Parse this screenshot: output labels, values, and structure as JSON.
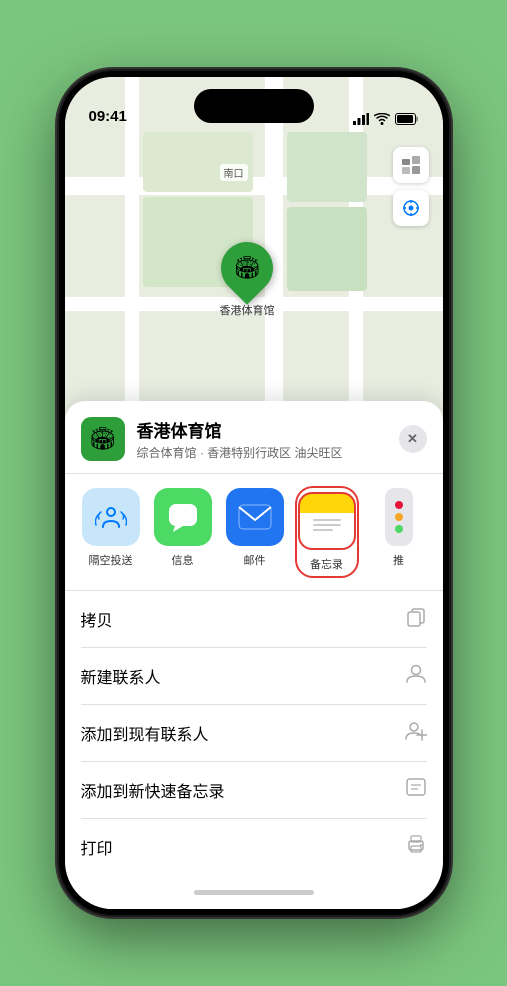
{
  "status_bar": {
    "time": "09:41",
    "signal": "●●●●",
    "wifi": "WiFi",
    "battery": "Battery"
  },
  "map": {
    "label_nk": "南口"
  },
  "venue": {
    "name": "香港体育馆",
    "subtitle": "综合体育馆 · 香港特别行政区 油尖旺区",
    "pin_label": "香港体育馆"
  },
  "close_button_label": "✕",
  "share_items": [
    {
      "id": "airdrop",
      "label": "隔空投送",
      "icon_type": "airdrop"
    },
    {
      "id": "messages",
      "label": "信息",
      "icon_type": "messages"
    },
    {
      "id": "mail",
      "label": "邮件",
      "icon_type": "mail"
    },
    {
      "id": "notes",
      "label": "备忘录",
      "icon_type": "notes"
    },
    {
      "id": "more",
      "label": "推",
      "icon_type": "more"
    }
  ],
  "actions": [
    {
      "id": "copy",
      "label": "拷贝",
      "icon": "📋"
    },
    {
      "id": "new-contact",
      "label": "新建联系人",
      "icon": "👤"
    },
    {
      "id": "add-existing",
      "label": "添加到现有联系人",
      "icon": "👤"
    },
    {
      "id": "quick-note",
      "label": "添加到新快速备忘录",
      "icon": "🖼"
    },
    {
      "id": "print",
      "label": "打印",
      "icon": "🖨"
    }
  ]
}
